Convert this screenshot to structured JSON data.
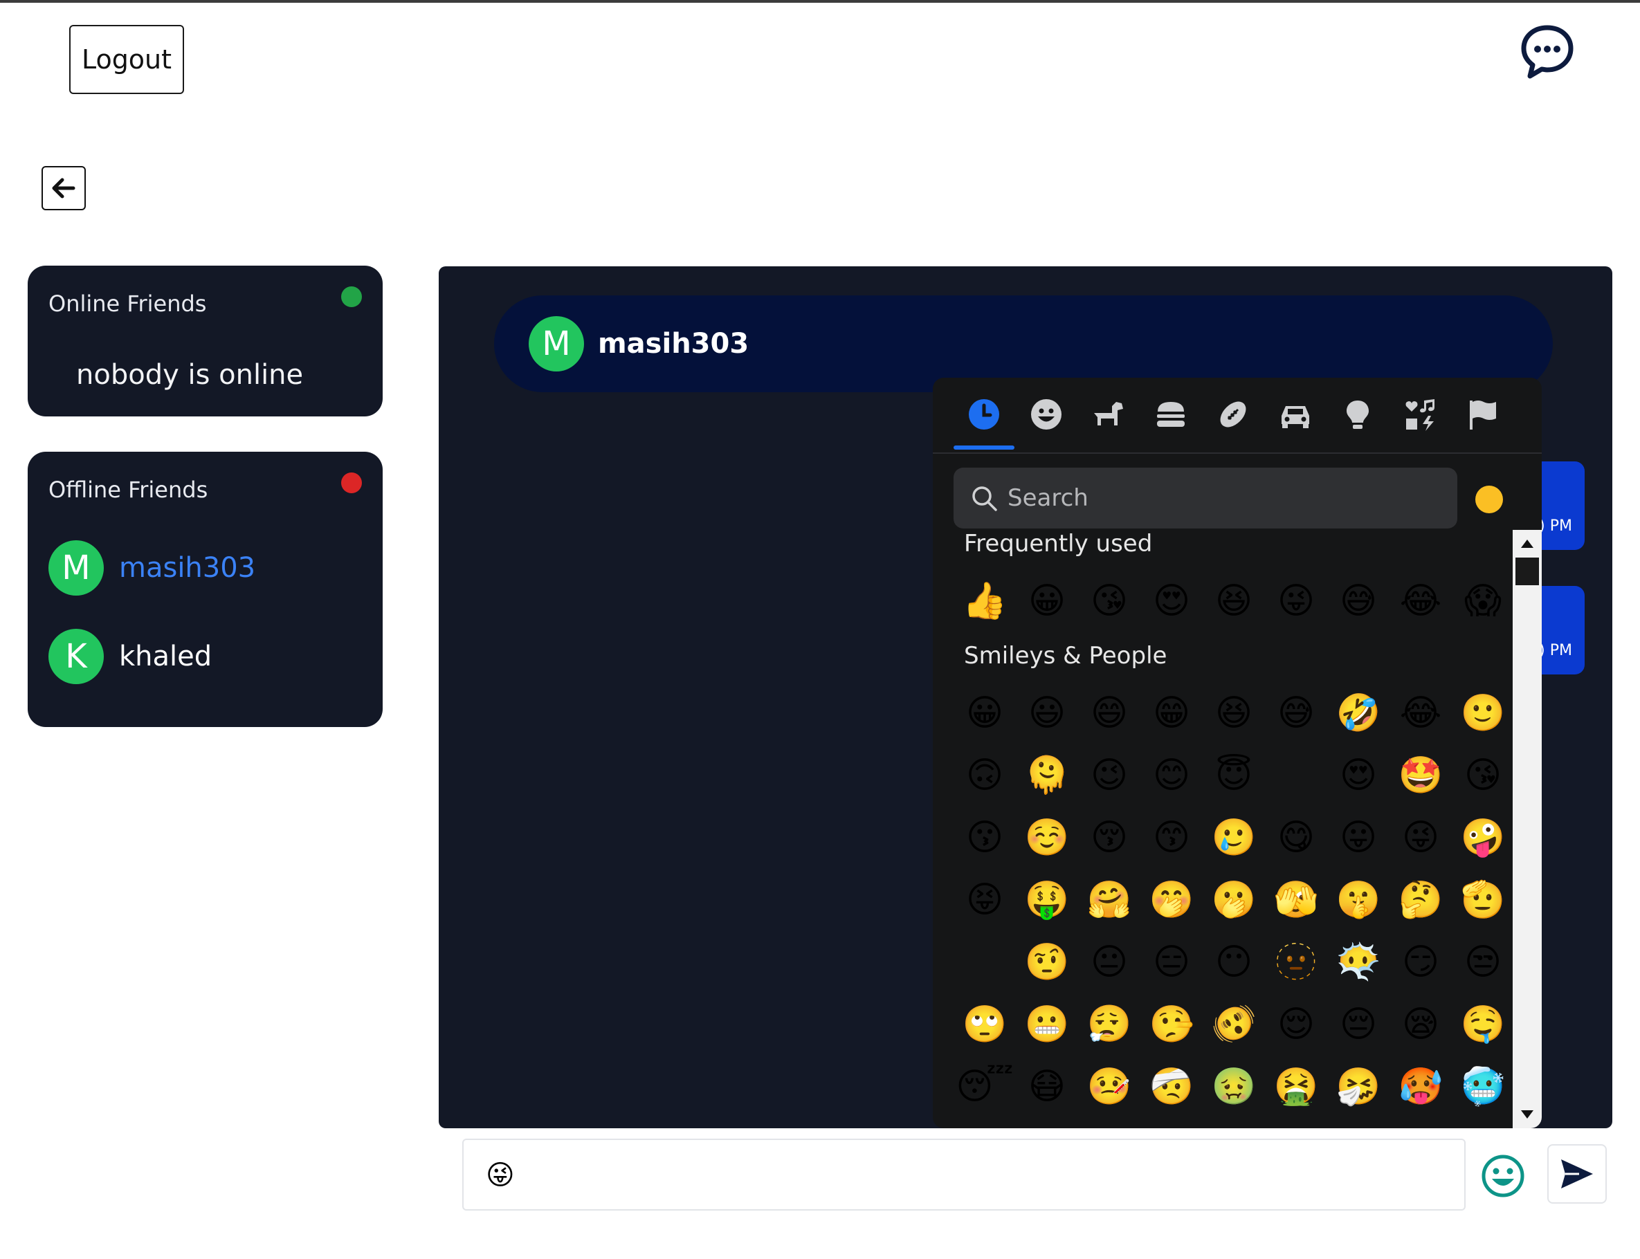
{
  "header": {
    "logout_label": "Logout",
    "chat_icon": "chat-bubble-ellipsis-icon",
    "back_icon": "arrow-left-icon"
  },
  "online_friends": {
    "title": "Online Friends",
    "status_color": "#22a447",
    "empty_text": "nobody is online"
  },
  "offline_friends": {
    "title": "Offline Friends",
    "status_color": "#dc2626",
    "items": [
      {
        "initial": "M",
        "name": "masih303",
        "active": true
      },
      {
        "initial": "K",
        "name": "khaled",
        "active": false
      }
    ]
  },
  "chat": {
    "contact_initial": "M",
    "contact_name": "masih303",
    "messages": [
      {
        "time_fragment": ") PM"
      },
      {
        "time_fragment": ") PM"
      }
    ]
  },
  "emoji_picker": {
    "active_category": "recent",
    "category_icons": [
      "clock-icon",
      "smiley-icon",
      "dog-icon",
      "burger-icon",
      "football-icon",
      "car-icon",
      "lightbulb-icon",
      "music-heart-icon",
      "flag-icon"
    ],
    "search_placeholder": "Search",
    "skin_tone_color": "#fbbf24",
    "frequently_used_title": "Frequently used",
    "frequently_used": [
      "👍",
      "😀",
      "😘",
      "😍",
      "😆",
      "😜",
      "😅",
      "😂",
      "😱"
    ],
    "smileys_title": "Smileys & People",
    "smileys": [
      "😀",
      "😃",
      "😄",
      "😁",
      "😆",
      "😅",
      "🤣",
      "😂",
      "🙂",
      "🙃",
      "🫠",
      "😉",
      "😊",
      "😇",
      "",
      "😍",
      "🤩",
      "😘",
      "😗",
      "☺️",
      "😚",
      "😙",
      "🥲",
      "😋",
      "😛",
      "😜",
      "🤪",
      "😝",
      "🤑",
      "🤗",
      "🤭",
      "🫢",
      "🫣",
      "🤫",
      "🤔",
      "🫡",
      "",
      "🤨",
      "😐",
      "😑",
      "😶",
      "🫥",
      "😶‍🌫️",
      "😏",
      "😒",
      "🙄",
      "😬",
      "😮‍💨",
      "🤥",
      "🫨",
      "😌",
      "😔",
      "😪",
      "🤤",
      "😴",
      "😷",
      "🤒",
      "🤕",
      "🤢",
      "🤮",
      "🤧",
      "🥵",
      "🥶"
    ]
  },
  "composer": {
    "value": "😜",
    "emoji_button_icon": "smiley-face-icon",
    "send_icon": "send-arrow-icon",
    "accent_color": "#0d9488"
  }
}
